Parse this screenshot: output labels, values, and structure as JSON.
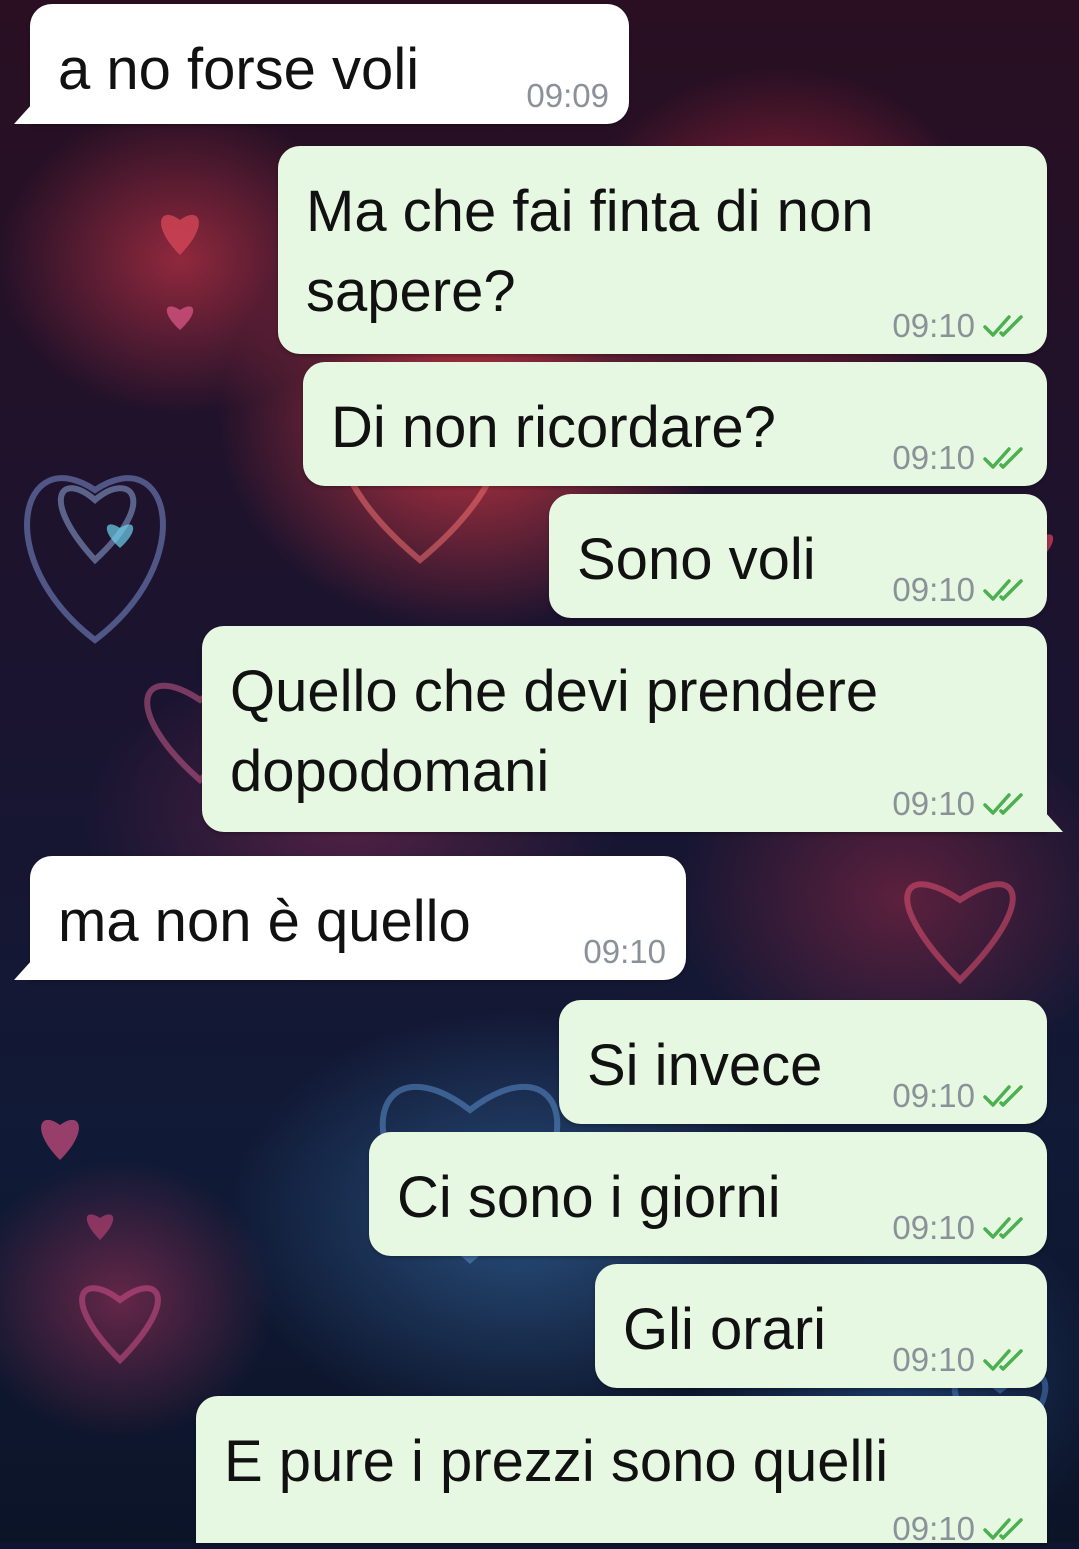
{
  "colors": {
    "incoming_bubble": "#ffffff",
    "outgoing_bubble": "#e7f8e2",
    "timestamp": "#8b9198",
    "read_ticks": "#4caf50"
  },
  "icons": {
    "read_receipt": "double-check-icon"
  },
  "messages": [
    {
      "direction": "in",
      "text": "a no forse voli",
      "time": "09:09"
    },
    {
      "direction": "out",
      "text": "Ma che fai finta di non\nsapere?",
      "time": "09:10",
      "status": "read"
    },
    {
      "direction": "out",
      "text": "Di non ricordare?",
      "time": "09:10",
      "status": "read"
    },
    {
      "direction": "out",
      "text": "Sono voli",
      "time": "09:10",
      "status": "read"
    },
    {
      "direction": "out",
      "text": "Quello che devi prendere\ndopodomani",
      "time": "09:10",
      "status": "read"
    },
    {
      "direction": "in",
      "text": "ma non è quello",
      "time": "09:10"
    },
    {
      "direction": "out",
      "text": "Si invece",
      "time": "09:10",
      "status": "read"
    },
    {
      "direction": "out",
      "text": "Ci sono i giorni",
      "time": "09:10",
      "status": "read"
    },
    {
      "direction": "out",
      "text": "Gli orari",
      "time": "09:10",
      "status": "read"
    },
    {
      "direction": "out",
      "text": "E pure i prezzi sono quelli",
      "time": "09:10",
      "status": "read"
    }
  ]
}
